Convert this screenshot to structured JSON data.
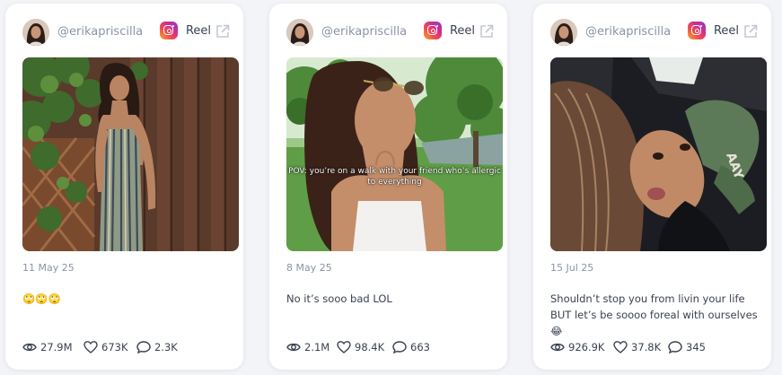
{
  "cards": [
    {
      "handle": "@erikapriscilla",
      "type": "Reel",
      "date": "11 May 25",
      "caption": "🙄🙄🙄",
      "overlay": "",
      "stats": {
        "views": "27.9M",
        "likes": "673K",
        "comments": "2.3K"
      }
    },
    {
      "handle": "@erikapriscilla",
      "type": "Reel",
      "date": "8 May 25",
      "caption": "No it’s sooo bad LOL",
      "overlay": "POV: you’re on a walk with your friend who’s allergic to everything",
      "stats": {
        "views": "2.1M",
        "likes": "98.4K",
        "comments": "663"
      }
    },
    {
      "handle": "@erikapriscilla",
      "type": "Reel",
      "date": "15 Jul 25",
      "caption": "Shouldn’t stop you from livin your life BUT let’s be soooo foreal with ourselves 😂",
      "overlay": "",
      "stats": {
        "views": "926.9K",
        "likes": "37.8K",
        "comments": "345"
      }
    }
  ],
  "icons": {
    "platform": "instagram-icon",
    "external": "external-link-icon",
    "views": "eye-icon",
    "likes": "heart-icon",
    "comments": "comment-icon"
  },
  "colors": {
    "background": "#f3f4f7",
    "card": "#ffffff",
    "muted_text": "#8a93a6",
    "body_text": "#3a4152"
  }
}
